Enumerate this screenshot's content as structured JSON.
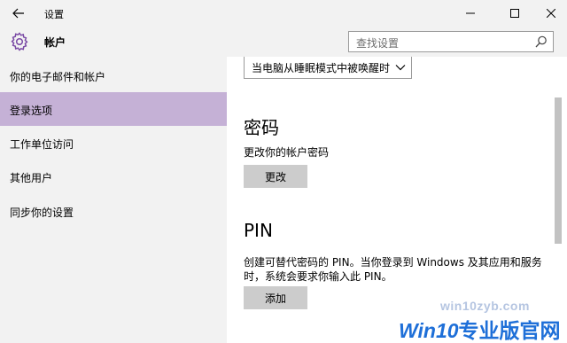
{
  "window": {
    "title": "设置",
    "back_icon": "arrow-left",
    "minimize_icon": "minimize",
    "maximize_icon": "maximize",
    "close_icon": "close"
  },
  "header": {
    "section_title": "帐户",
    "section_icon": "gear",
    "search_placeholder": "查找设置",
    "search_icon": "search"
  },
  "sidebar": {
    "items": [
      {
        "label": "你的电子邮件和帐户",
        "active": false
      },
      {
        "label": "登录选项",
        "active": true
      },
      {
        "label": "工作单位访问",
        "active": false
      },
      {
        "label": "其他用户",
        "active": false
      },
      {
        "label": "同步你的设置",
        "active": false
      }
    ]
  },
  "main": {
    "require_signin_dropdown": {
      "value": "当电脑从睡眠模式中被唤醒时"
    },
    "password": {
      "heading": "密码",
      "description": "更改你的帐户密码",
      "button": "更改"
    },
    "pin": {
      "heading": "PIN",
      "description_line1": "创建可替代密码的 PIN。当你登录到 Windows 及其应用和服务",
      "description_line2": "时，系统会要求你输入此 PIN。",
      "button": "添加"
    }
  },
  "watermark": {
    "url": "win10zyb.com",
    "brand_prefix": "Win10",
    "brand_suffix": "专业版官网"
  },
  "colors": {
    "chrome_bg": "#f2f2f2",
    "selected_nav": "#c5b1d6",
    "accent_gear": "#7a4aa5",
    "button_bg": "#cccccc",
    "watermark_blue": "#1e6fd8"
  }
}
